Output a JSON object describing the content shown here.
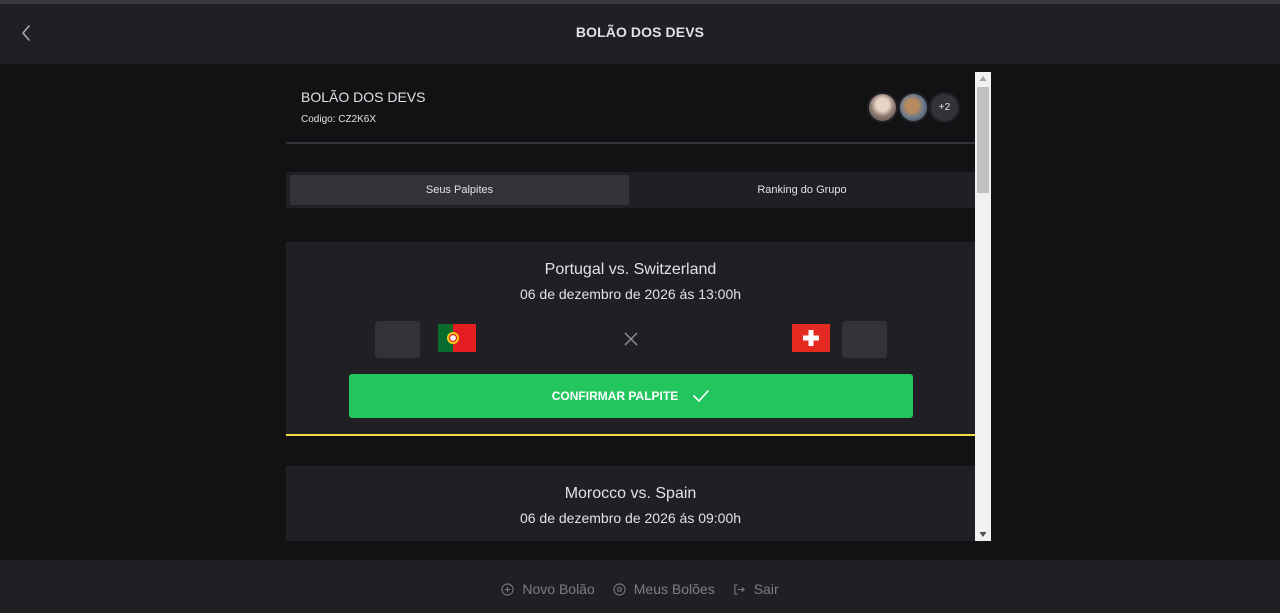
{
  "header": {
    "title": "BOLÃO DOS DEVS",
    "back_icon": "chevron-left-icon"
  },
  "pool": {
    "name": "BOLÃO DOS DEVS",
    "code_text": "Codigo: CZ2K6X",
    "participants_more": "+2"
  },
  "tabs": [
    {
      "label": "Seus Palpites",
      "active": true
    },
    {
      "label": "Ranking do Grupo",
      "active": false
    }
  ],
  "matches": [
    {
      "title": "Portugal vs. Switzerland",
      "date": "06 de dezembro de 2026 ás 13:00h",
      "home_flag": "portugal-flag-icon",
      "away_flag": "switzerland-flag-icon",
      "home_score": "",
      "away_score": "",
      "confirm_label": "CONFIRMAR PALPITE"
    },
    {
      "title": "Morocco vs. Spain",
      "date": "06 de dezembro de 2026 ás 09:00h"
    }
  ],
  "footer": {
    "items": [
      {
        "label": "Novo Bolão",
        "icon": "plus-circle-icon"
      },
      {
        "label": "Meus Bolões",
        "icon": "soccer-ball-icon"
      },
      {
        "label": "Sair",
        "icon": "sign-out-icon"
      }
    ]
  },
  "colors": {
    "background": "#121214",
    "surface": "#202024",
    "input": "#323238",
    "accent_green": "#22c55e",
    "accent_yellow": "#f7dd43",
    "text": "#e1e1e6",
    "muted": "#7c7c8a"
  }
}
